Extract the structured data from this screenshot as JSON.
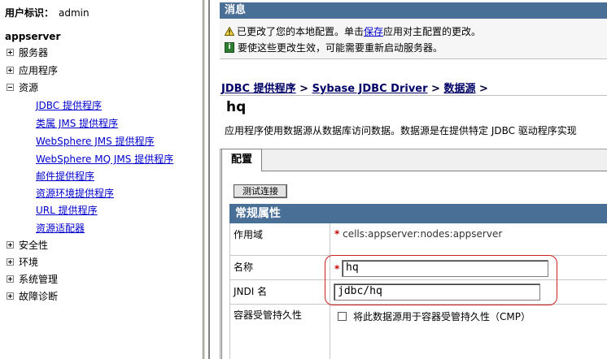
{
  "user": {
    "label": "用户标识：",
    "value": "admin"
  },
  "nav": {
    "server": "appserver",
    "items": [
      {
        "label": "服务器"
      },
      {
        "label": "应用程序"
      },
      {
        "label": "资源"
      },
      {
        "label": "安全性"
      },
      {
        "label": "环境"
      },
      {
        "label": "系统管理"
      },
      {
        "label": "故障诊断"
      }
    ],
    "resources": [
      "JDBC 提供程序",
      "类属 JMS 提供程序",
      "WebSphere JMS 提供程序",
      "WebSphere MQ JMS 提供程序",
      "邮件提供程序",
      "资源环境提供程序",
      "URL 提供程序",
      "资源适配器"
    ]
  },
  "messages": {
    "title": "消息",
    "line1_before": "已更改了您的本地配置。单击",
    "line1_link": "保存",
    "line1_after": "应用对主配置的更改。",
    "line2": "要使这些更改生效，可能需要重新启动服务器。"
  },
  "breadcrumb": {
    "items": [
      "JDBC 提供程序",
      "Sybase JDBC Driver",
      "数据源"
    ],
    "sep": " > ",
    "trail": " >"
  },
  "page": {
    "title": "hq",
    "description": "应用程序使用数据源从数据库访问数据。数据源是在提供特定 JDBC 驱动程序实现"
  },
  "tab": {
    "label": "配置"
  },
  "test_button": "测试连接",
  "section": "常规属性",
  "fields": {
    "scope": {
      "label": "作用域",
      "value": "cells:appserver:nodes:appserver"
    },
    "name": {
      "label": "名称",
      "value": "hq"
    },
    "jndi": {
      "label": "JNDI 名",
      "value": "jdbc/hq"
    },
    "cmp": {
      "label": "容器受管持久性",
      "checkbox_label": "将此数据源用于容器受管持久性（CMP）"
    }
  },
  "required_mark": "*"
}
